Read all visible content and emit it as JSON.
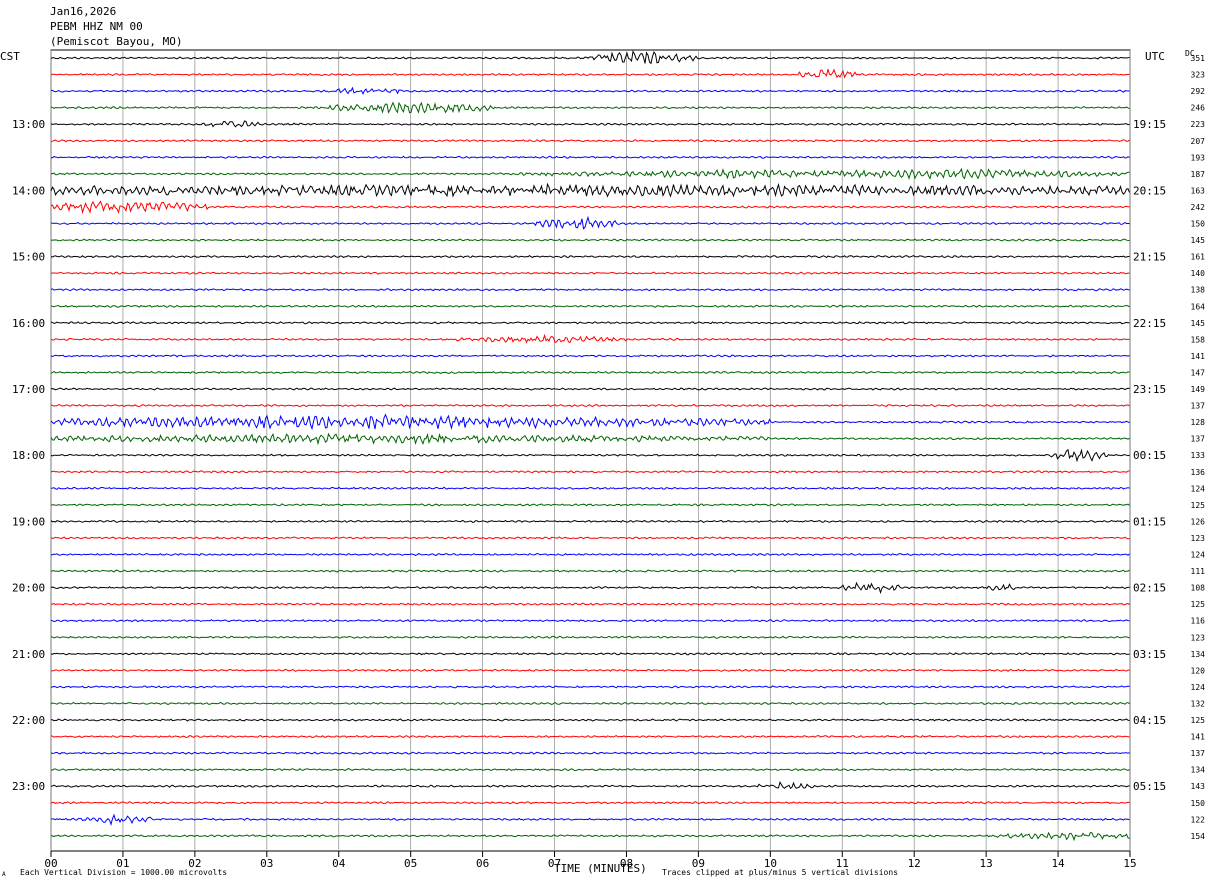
{
  "header": {
    "date": "Jan16,2026",
    "station": "PEBM HHZ NM 00",
    "location": "(Pemiscot Bayou, MO)"
  },
  "left_tz": "CST",
  "right_tz": "UTC",
  "dc_label": "DC",
  "footer": {
    "scale_note": "Each Vertical Division = 1000.00 microvolts",
    "clip_note": "Traces clipped at plus/minus 5 vertical divisions",
    "corner_mark": "A"
  },
  "colors": [
    "#000000",
    "#ff0000",
    "#0000ff",
    "#006400"
  ],
  "chart_data": {
    "type": "line",
    "xlabel": "TIME (MINUTES)",
    "x_ticks": [
      "00",
      "01",
      "02",
      "03",
      "04",
      "05",
      "06",
      "07",
      "08",
      "09",
      "10",
      "11",
      "12",
      "13",
      "14",
      "15"
    ],
    "xlim": [
      0,
      15
    ],
    "grid": true,
    "left_time_labels": [
      "13:00",
      "14:00",
      "15:00",
      "16:00",
      "17:00",
      "18:00",
      "19:00",
      "20:00",
      "21:00",
      "22:00",
      "23:00"
    ],
    "right_time_labels": [
      "19:15",
      "20:15",
      "21:15",
      "22:15",
      "23:15",
      "00:15",
      "01:15",
      "02:15",
      "03:15",
      "04:15",
      "05:15"
    ],
    "dc_offsets": [
      351,
      323,
      292,
      246,
      223,
      207,
      193,
      187,
      163,
      242,
      150,
      145,
      161,
      140,
      138,
      164,
      145,
      158,
      141,
      147,
      149,
      137,
      128,
      137,
      133,
      136,
      124,
      125,
      126,
      123,
      124,
      111,
      108,
      125,
      116,
      123,
      134,
      120,
      124,
      132,
      125,
      141,
      137,
      134,
      143,
      150,
      122,
      154
    ]
  }
}
